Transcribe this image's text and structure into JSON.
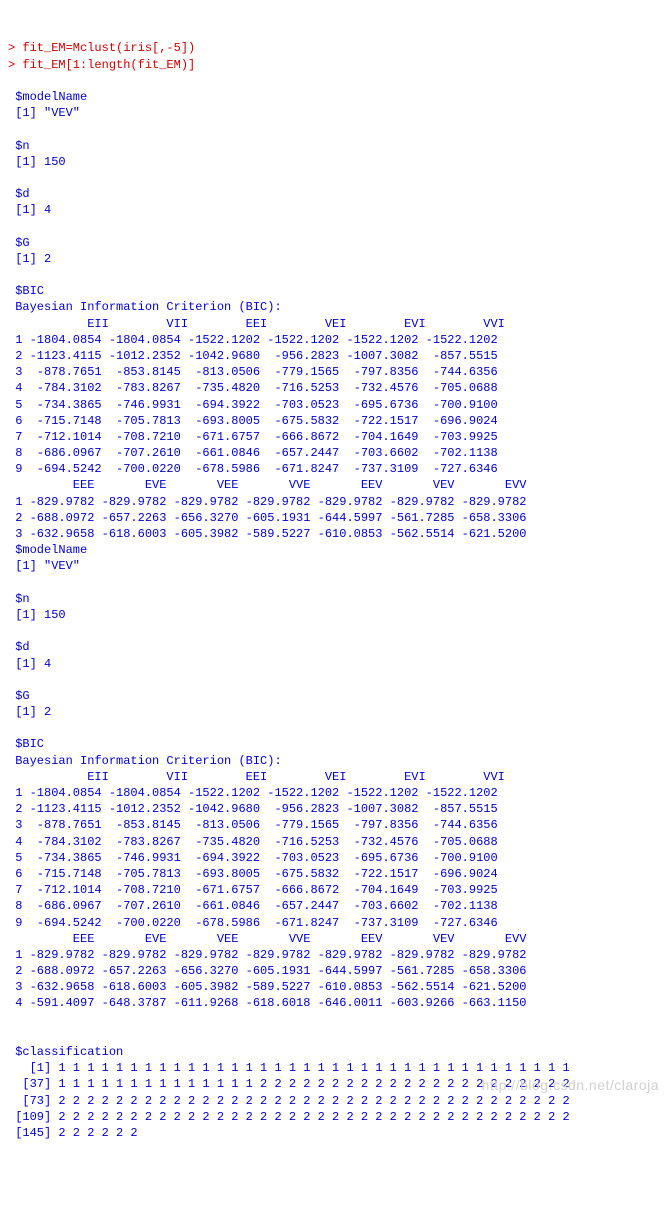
{
  "cmd1": "> fit_EM=Mclust(iris[,-5])",
  "cmd2": "> fit_EM[1:length(fit_EM)]",
  "block1": {
    "modelName_hdr": " $modelName",
    "modelName_val": " [1] \"VEV\"",
    "n_hdr": " $n",
    "n_val": " [1] 150",
    "d_hdr": " $d",
    "d_val": " [1] 4",
    "G_hdr": " $G",
    "G_val": " [1] 2",
    "BIC_hdr": " $BIC",
    "BIC_title": " Bayesian Information Criterion (BIC):",
    "BIC_col1": "           EII        VII        EEI        VEI        EVI        VVI",
    "BIC_r1": " 1 -1804.0854 -1804.0854 -1522.1202 -1522.1202 -1522.1202 -1522.1202",
    "BIC_r2": " 2 -1123.4115 -1012.2352 -1042.9680  -956.2823 -1007.3082  -857.5515",
    "BIC_r3": " 3  -878.7651  -853.8145  -813.0506  -779.1565  -797.8356  -744.6356",
    "BIC_r4": " 4  -784.3102  -783.8267  -735.4820  -716.5253  -732.4576  -705.0688",
    "BIC_r5": " 5  -734.3865  -746.9931  -694.3922  -703.0523  -695.6736  -700.9100",
    "BIC_r6": " 6  -715.7148  -705.7813  -693.8005  -675.5832  -722.1517  -696.9024",
    "BIC_r7": " 7  -712.1014  -708.7210  -671.6757  -666.8672  -704.1649  -703.9925",
    "BIC_r8": " 8  -686.0967  -707.2610  -661.0846  -657.2447  -703.6602  -702.1138",
    "BIC_r9": " 9  -694.5242  -700.0220  -678.5986  -671.8247  -737.3109  -727.6346",
    "BIC_col2": "         EEE       EVE       VEE       VVE       EEV       VEV       EVV",
    "BIC_s1": " 1 -829.9782 -829.9782 -829.9782 -829.9782 -829.9782 -829.9782 -829.9782",
    "BIC_s2": " 2 -688.0972 -657.2263 -656.3270 -605.1931 -644.5997 -561.7285 -658.3306",
    "BIC_s3": " 3 -632.9658 -618.6003 -605.3982 -589.5227 -610.0853 -562.5514 -621.5200"
  },
  "block2": {
    "modelName_hdr": " $modelName",
    "modelName_val": " [1] \"VEV\"",
    "n_hdr": " $n",
    "n_val": " [1] 150",
    "d_hdr": " $d",
    "d_val": " [1] 4",
    "G_hdr": " $G",
    "G_val": " [1] 2",
    "BIC_hdr": " $BIC",
    "BIC_title": " Bayesian Information Criterion (BIC):",
    "BIC_col1": "           EII        VII        EEI        VEI        EVI        VVI",
    "BIC_r1": " 1 -1804.0854 -1804.0854 -1522.1202 -1522.1202 -1522.1202 -1522.1202",
    "BIC_r2": " 2 -1123.4115 -1012.2352 -1042.9680  -956.2823 -1007.3082  -857.5515",
    "BIC_r3": " 3  -878.7651  -853.8145  -813.0506  -779.1565  -797.8356  -744.6356",
    "BIC_r4": " 4  -784.3102  -783.8267  -735.4820  -716.5253  -732.4576  -705.0688",
    "BIC_r5": " 5  -734.3865  -746.9931  -694.3922  -703.0523  -695.6736  -700.9100",
    "BIC_r6": " 6  -715.7148  -705.7813  -693.8005  -675.5832  -722.1517  -696.9024",
    "BIC_r7": " 7  -712.1014  -708.7210  -671.6757  -666.8672  -704.1649  -703.9925",
    "BIC_r8": " 8  -686.0967  -707.2610  -661.0846  -657.2447  -703.6602  -702.1138",
    "BIC_r9": " 9  -694.5242  -700.0220  -678.5986  -671.8247  -737.3109  -727.6346",
    "BIC_col2": "         EEE       EVE       VEE       VVE       EEV       VEV       EVV",
    "BIC_s1": " 1 -829.9782 -829.9782 -829.9782 -829.9782 -829.9782 -829.9782 -829.9782",
    "BIC_s2": " 2 -688.0972 -657.2263 -656.3270 -605.1931 -644.5997 -561.7285 -658.3306",
    "BIC_s3": " 3 -632.9658 -618.6003 -605.3982 -589.5227 -610.0853 -562.5514 -621.5200",
    "BIC_s4": " 4 -591.4097 -648.3787 -611.9268 -618.6018 -646.0011 -603.9266 -663.1150"
  },
  "class": {
    "hdr": " $classification",
    "r1": "   [1] 1 1 1 1 1 1 1 1 1 1 1 1 1 1 1 1 1 1 1 1 1 1 1 1 1 1 1 1 1 1 1 1 1 1 1 1",
    "r2": "  [37] 1 1 1 1 1 1 1 1 1 1 1 1 1 1 2 2 2 2 2 2 2 2 2 2 2 2 2 2 2 2 2 2 2 2 2 2",
    "r3": "  [73] 2 2 2 2 2 2 2 2 2 2 2 2 2 2 2 2 2 2 2 2 2 2 2 2 2 2 2 2 2 2 2 2 2 2 2 2",
    "r4": " [109] 2 2 2 2 2 2 2 2 2 2 2 2 2 2 2 2 2 2 2 2 2 2 2 2 2 2 2 2 2 2 2 2 2 2 2 2",
    "r5": " [145] 2 2 2 2 2 2"
  },
  "watermark": "http://blog.csdn.net/claroja"
}
